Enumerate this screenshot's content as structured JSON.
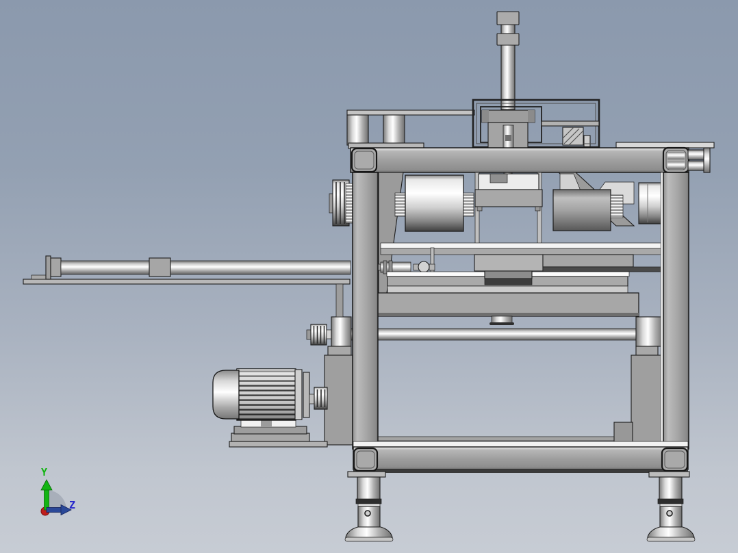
{
  "viewport": {
    "description": "Shaded 3D CAD side view of an industrial press / conveyor machine assembly on a blue-gray gradient backdrop",
    "view_orientation": "side",
    "background_top": "#8b99ad",
    "background_bottom": "#c7ccd4"
  },
  "axis_triad": {
    "y_label": "Y",
    "z_label": "Z",
    "y_color": "#12b412",
    "z_label_color": "#2626cc",
    "z_arrow_color": "#2a4898",
    "origin_color": "#bf1d1d",
    "arc_color": "#9aa2ae"
  },
  "machine": {
    "base_gray": "#a0a0a0",
    "outline_color": "#1d1d1d",
    "highlight_color": "#f6f6f6",
    "dark_accent": "#3d3d3d",
    "parts": [
      "lift-cylinder",
      "gantry-frame",
      "support-shelf",
      "top-plate",
      "end-cylinder",
      "top-beam",
      "left-column",
      "right-column",
      "left-groove-pulley",
      "main-drum",
      "right-drum",
      "white-roller",
      "press-carriage",
      "guide-rails",
      "work-table",
      "feed-rod",
      "feed-rod-plate",
      "drive-shaft",
      "shaft-pulley",
      "left-bearing",
      "right-bearing",
      "left-pedestal",
      "right-pedestal",
      "electric-motor",
      "motor-pulley",
      "bottom-beam",
      "left-leveling-foot",
      "right-leveling-foot"
    ]
  }
}
